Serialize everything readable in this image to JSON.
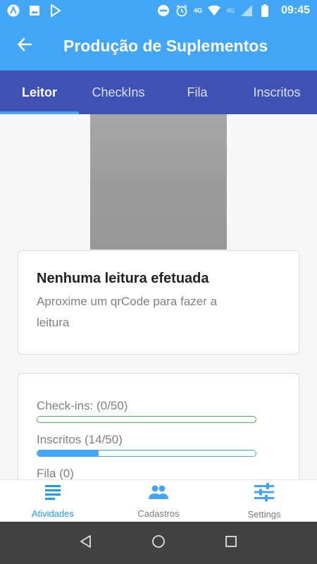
{
  "status_bar": {
    "time": "09:45",
    "network_primary": "4G",
    "network_secondary": "4G",
    "icons_left": [
      "a-app-icon",
      "image-icon",
      "play-store-icon"
    ],
    "icons_right": [
      "do-not-disturb-icon",
      "alarm-icon",
      "signal-icon",
      "wifi-icon",
      "battery-icon"
    ]
  },
  "app_bar": {
    "title": "Produção de Suplementos",
    "back_icon": "arrow-left-icon"
  },
  "tabs": [
    {
      "label": "Leitor",
      "active": true
    },
    {
      "label": "CheckIns",
      "active": false
    },
    {
      "label": "Fila",
      "active": false
    },
    {
      "label": "Inscritos",
      "active": false
    }
  ],
  "reading_card": {
    "title": "Nenhuma leitura efetuada",
    "subtitle_line1": "Aproxime um qrCode para fazer a",
    "subtitle_line2": "leitura"
  },
  "stats": {
    "checkins": {
      "label": "Check-ins: (0/50)",
      "progress": 0.0,
      "color": "#4caf50"
    },
    "inscritos": {
      "label": "Inscritos (14/50)",
      "progress": 0.28,
      "color": "#42a5f5"
    },
    "fila": {
      "label": "Fila (0)"
    }
  },
  "bottom_nav": [
    {
      "label": "Atividades",
      "icon": "list-icon",
      "active": true
    },
    {
      "label": "Cadastros",
      "icon": "people-icon",
      "active": false
    },
    {
      "label": "Settings",
      "icon": "sliders-icon",
      "active": false
    }
  ],
  "colors": {
    "primary": "#42a5f5",
    "tab_bar": "#3f51b5",
    "active_nav": "#2196f3"
  }
}
